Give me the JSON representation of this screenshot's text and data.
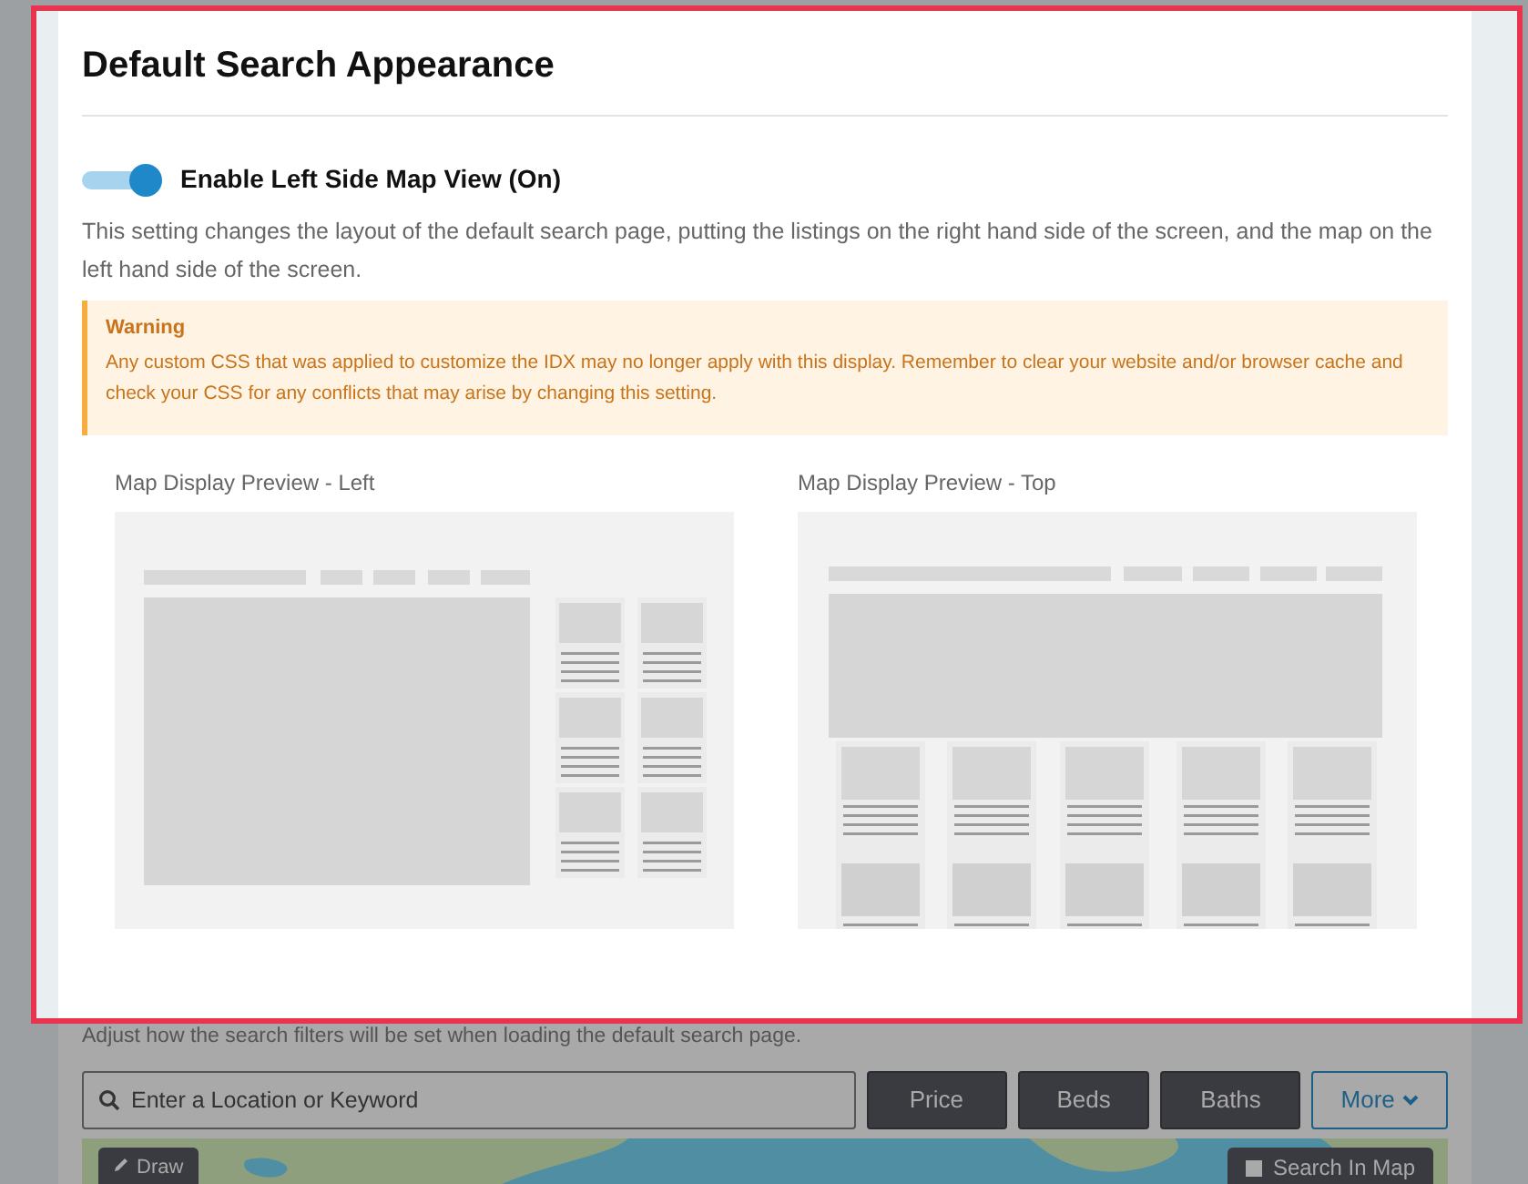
{
  "title": "Default Search Appearance",
  "toggle": {
    "label": "Enable Left Side Map View (On)",
    "on": true
  },
  "description": "This setting changes the layout of the default search page, putting the listings on the right hand side of the screen, and the map on the left hand side of the screen.",
  "warning": {
    "title": "Warning",
    "text": "Any custom CSS that was applied to customize the IDX may no longer apply with this display. Remember to clear your website and/or browser cache and check your CSS for any conflicts that may arise by changing this setting."
  },
  "previews": [
    {
      "label": "Map Display Preview - Left",
      "kind": "left"
    },
    {
      "label": "Map Display Preview - Top",
      "kind": "top"
    }
  ],
  "filters": {
    "description": "Adjust how the search filters will be set when loading the default search page.",
    "search": {
      "placeholder": "Enter a Location or Keyword"
    },
    "buttons": [
      {
        "label": "Price",
        "kind": "dark"
      },
      {
        "label": "Beds",
        "kind": "dark"
      },
      {
        "label": "Baths",
        "kind": "dark"
      },
      {
        "label": "More",
        "kind": "outline"
      }
    ],
    "map": {
      "kind": "picture",
      "draw_button": "Draw",
      "search_in_map": {
        "label": "Search In Map",
        "checked": false
      }
    }
  }
}
